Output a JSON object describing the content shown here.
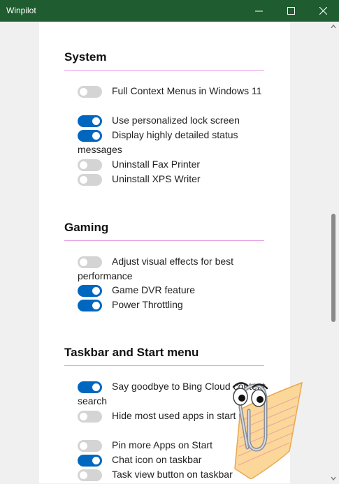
{
  "window": {
    "title": "Winpilot"
  },
  "sections": [
    {
      "title": "System",
      "options": [
        {
          "label": "Full Context Menus in Windows 11",
          "on": false
        },
        {
          "label": "Use personalized lock screen",
          "on": true
        },
        {
          "label": "Display highly detailed status messages",
          "on": true
        },
        {
          "label": "Uninstall Fax Printer",
          "on": false
        },
        {
          "label": "Uninstall XPS Writer",
          "on": false
        }
      ]
    },
    {
      "title": "Gaming",
      "options": [
        {
          "label": "Adjust visual effects for best performance",
          "on": false
        },
        {
          "label": "Game DVR feature",
          "on": true
        },
        {
          "label": "Power Throttling",
          "on": true
        }
      ]
    },
    {
      "title": "Taskbar and Start menu",
      "options": [
        {
          "label": "Say goodbye to Bing Cloud content search",
          "on": true
        },
        {
          "label": "Hide most used apps in start menu",
          "on": false
        },
        {
          "label": "Pin more Apps on Start",
          "on": false
        },
        {
          "label": "Chat icon on taskbar",
          "on": true
        },
        {
          "label": "Task view button on taskbar",
          "on": false
        }
      ]
    }
  ],
  "colors": {
    "titlebar": "#1f5c2f",
    "toggle_on": "#0067c0",
    "toggle_off": "#d4d4d4",
    "section_rule": "#e6a0e6"
  },
  "icons": {
    "minimize": "minimize-icon",
    "maximize": "maximize-icon",
    "close": "close-icon",
    "assistant": "paperclip-assistant-icon"
  }
}
